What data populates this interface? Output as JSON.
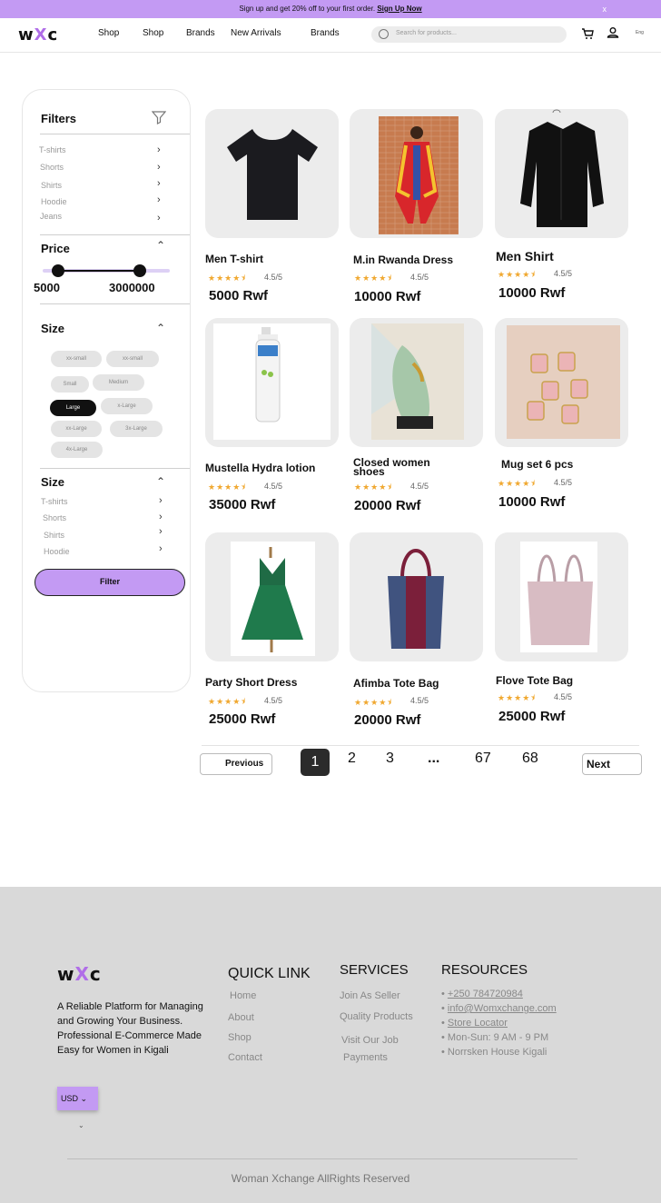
{
  "promo": {
    "text": "Sign up and get 20% off to your first order.",
    "link": "Sign Up Now",
    "close": "x"
  },
  "header": {
    "logo_pre": "w",
    "logo_x": "X",
    "logo_post": "c",
    "nav": [
      "Shop",
      "Shop",
      "Brands",
      "New Arrivals",
      "Brands"
    ],
    "search_placeholder": "Search for products...",
    "cart_icon": "cart-icon",
    "user_icon": "user-icon",
    "lang": "Eng"
  },
  "sidebar": {
    "title": "Filters",
    "categories": [
      "T-shirts",
      "Shorts",
      "Shirts",
      "Hoodie",
      "Jeans"
    ],
    "price_title": "Price",
    "price_min": "5000",
    "price_max": "3000000",
    "size_title": "Size",
    "sizes": [
      "xx-small",
      "xx-small",
      "Small",
      "Medium",
      "Large",
      "x-Large",
      "xx-Large",
      "3x-Large",
      "4x-Large"
    ],
    "active_size": "Large",
    "size2_title": "Size",
    "categories2": [
      "T-shirts",
      "Shorts",
      "Shirts",
      "Hoodie"
    ],
    "filter_button": "Filter"
  },
  "products": [
    {
      "name": "Men T-shirt",
      "stars": "★★★★⯨",
      "rating": "4.5/5",
      "price": "5000 Rwf"
    },
    {
      "name": "M.in Rwanda Dress",
      "stars": "★★★★⯨",
      "rating": "4.5/5",
      "price": "10000 Rwf"
    },
    {
      "name": "Men Shirt",
      "stars": "★★★★⯨",
      "rating": "4.5/5",
      "price": "10000 Rwf"
    },
    {
      "name": "Mustella Hydra   lotion",
      "stars": "★★★★⯨",
      "rating": "4.5/5",
      "price": "35000 Rwf"
    },
    {
      "name": "Closed women shoes",
      "stars": "★★★★⯨",
      "rating": "4.5/5",
      "price": "20000 Rwf"
    },
    {
      "name": "Mug set 6 pcs",
      "stars": "★★★★⯨",
      "rating": "4.5/5",
      "price": "10000 Rwf"
    },
    {
      "name": "Party Short Dress",
      "stars": "★★★★⯨",
      "rating": "4.5/5",
      "price": "25000 Rwf"
    },
    {
      "name": "Afimba Tote Bag",
      "stars": "★★★★⯨",
      "rating": "4.5/5",
      "price": "20000 Rwf"
    },
    {
      "name": "Flove Tote Bag",
      "stars": "★★★★⯨",
      "rating": "4.5/5",
      "price": "25000 Rwf"
    }
  ],
  "pagination": {
    "previous": "Previous",
    "next": "Next",
    "pages": [
      "1",
      "2",
      "3",
      "...",
      "67",
      "68"
    ],
    "current": "1"
  },
  "footer": {
    "logo_pre": "w",
    "logo_x": "X",
    "logo_post": "c",
    "description": "A Reliable Platform for Managing and Growing Your Business. Professional E-Commerce Made Easy for Women in Kigali",
    "quick_title": "QUICK LINK",
    "quick_links": [
      "Home",
      "About",
      "Shop",
      "Contact"
    ],
    "services_title": "SERVICES",
    "services": [
      "Join As Seller",
      "Quality Products",
      "Visit Our Job",
      "Payments"
    ],
    "resources_title": "RESOURCES",
    "resources": [
      "+250 784720984",
      "info@Womxchange.com",
      "Store Locator",
      "Mon-Sun: 9 AM - 9 PM",
      "Norrsken House Kigali"
    ],
    "currency": "USD",
    "copyright": "Woman Xchange AllRights Reserved"
  },
  "colors": {
    "accent": "#c39af3",
    "logo_x": "#b06ee8",
    "star": "#f0a830"
  }
}
